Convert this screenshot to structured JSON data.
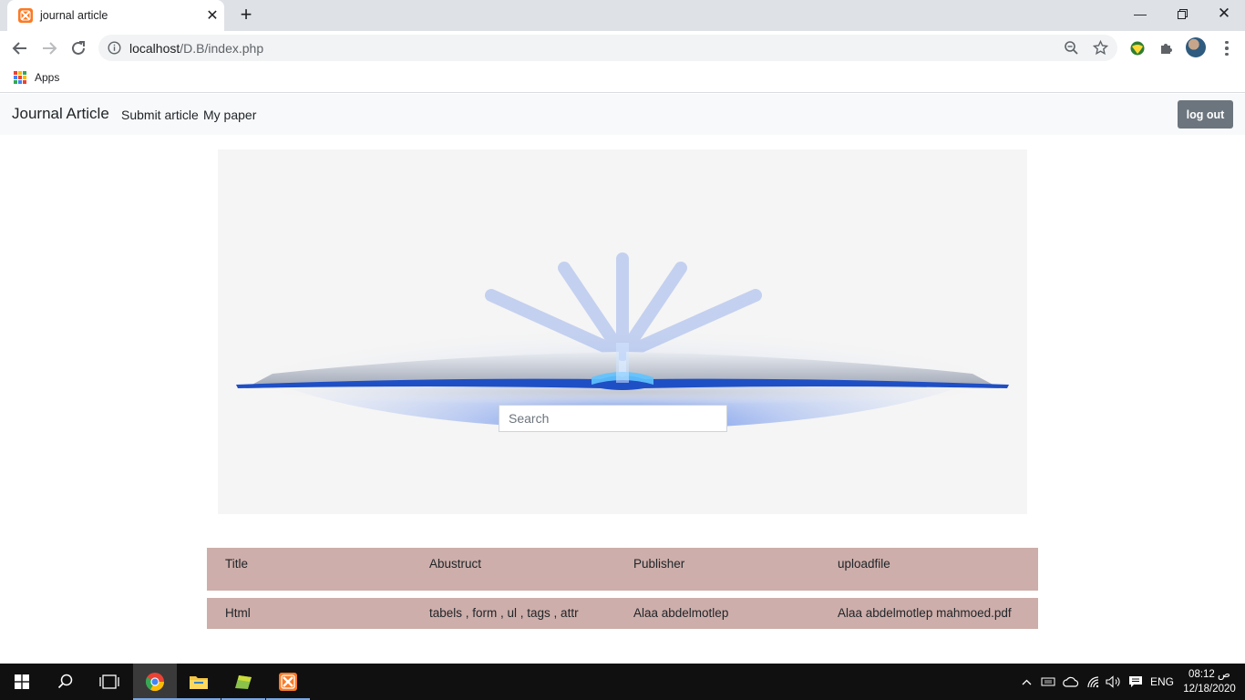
{
  "browser": {
    "tab_title": "journal article",
    "new_tab_icon": "plus-icon",
    "url_host": "localhost",
    "url_path": "/D.B/index.php",
    "bookmarks_apps_label": "Apps"
  },
  "navbar": {
    "brand": "Journal Article",
    "links": [
      "Submit article",
      "My paper"
    ],
    "logout_label": "log out"
  },
  "hero": {
    "search_placeholder": "Search"
  },
  "table": {
    "headers": [
      "Title",
      "Abustruct",
      "Publisher",
      "uploadfile"
    ],
    "rows": [
      [
        "Html",
        "tabels , form , ul , tags , attr",
        "Alaa abdelmotlep",
        "Alaa abdelmotlep mahmoed.pdf"
      ]
    ]
  },
  "taskbar": {
    "language": "ENG",
    "time": "08:12 ص",
    "date": "12/18/2020"
  },
  "colors": {
    "navbar_bg": "#f8f9fa",
    "logout_bg": "#6c757d",
    "table_row_bg": "#cdaeaa",
    "hero_bg": "#f5f5f5"
  }
}
